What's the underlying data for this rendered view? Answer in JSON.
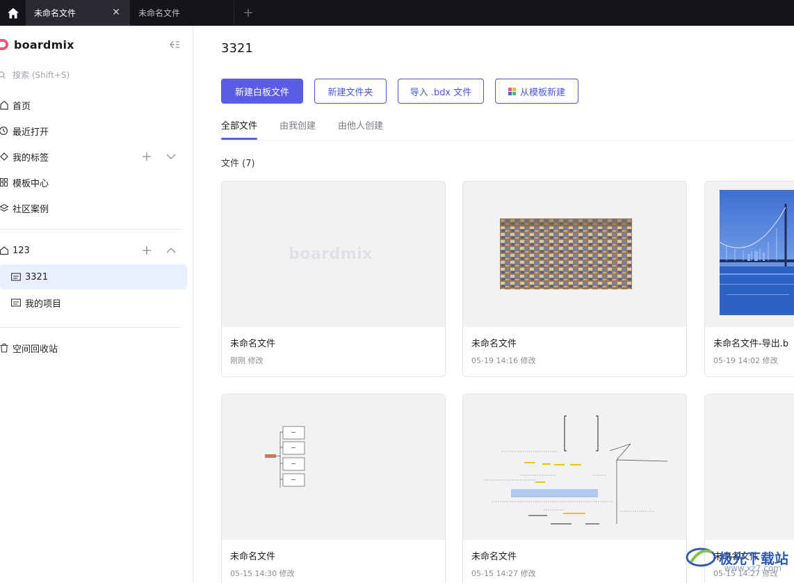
{
  "tabs": [
    {
      "label": "未命名文件",
      "active": true
    },
    {
      "label": "未命名文件",
      "active": false
    }
  ],
  "sidebar": {
    "logo": "boardmix",
    "search_placeholder": "搜索 (Shift+S)",
    "items": [
      {
        "label": "首页",
        "icon": "home-icon"
      },
      {
        "label": "最近打开",
        "icon": "clock-icon"
      },
      {
        "label": "我的标签",
        "icon": "tag-icon"
      },
      {
        "label": "模板中心",
        "icon": "grid-icon"
      },
      {
        "label": "社区案例",
        "icon": "layers-icon"
      }
    ],
    "team": {
      "label": "123",
      "icon": "house-icon"
    },
    "folders": [
      {
        "label": "3321",
        "selected": true
      },
      {
        "label": "我的项目",
        "selected": false
      }
    ],
    "trash": "空间回收站"
  },
  "main": {
    "title": "3321",
    "buttons": {
      "new_board": "新建白板文件",
      "new_folder": "新建文件夹",
      "import": "导入 .bdx 文件",
      "from_template": "从模板新建"
    },
    "tabs": [
      {
        "label": "全部文件",
        "active": true
      },
      {
        "label": "由我创建",
        "active": false
      },
      {
        "label": "由他人创建",
        "active": false
      }
    ],
    "file_count": "文件 (7)",
    "files": [
      {
        "name": "未命名文件",
        "meta": "刚刚 修改",
        "thumb_text": "boardmix"
      },
      {
        "name": "未命名文件",
        "meta": "05-19 14:16 修改"
      },
      {
        "name": "未命名文件-导出.b",
        "meta": "05-19 14:02 修改"
      },
      {
        "name": "未命名文件",
        "meta": "05-15 14:30 修改"
      },
      {
        "name": "未命名文件",
        "meta": "05-15 14:27 修改"
      },
      {
        "name": "未命名文件",
        "meta": "05-15 14:27 修改"
      }
    ]
  },
  "watermark": {
    "text": "极光下载站",
    "url": "www.xz7.com"
  },
  "colors": {
    "accent": "#5b5ce6",
    "brand": "#f2557a",
    "tabbar": "#16141b",
    "selected": "#e9efff"
  }
}
